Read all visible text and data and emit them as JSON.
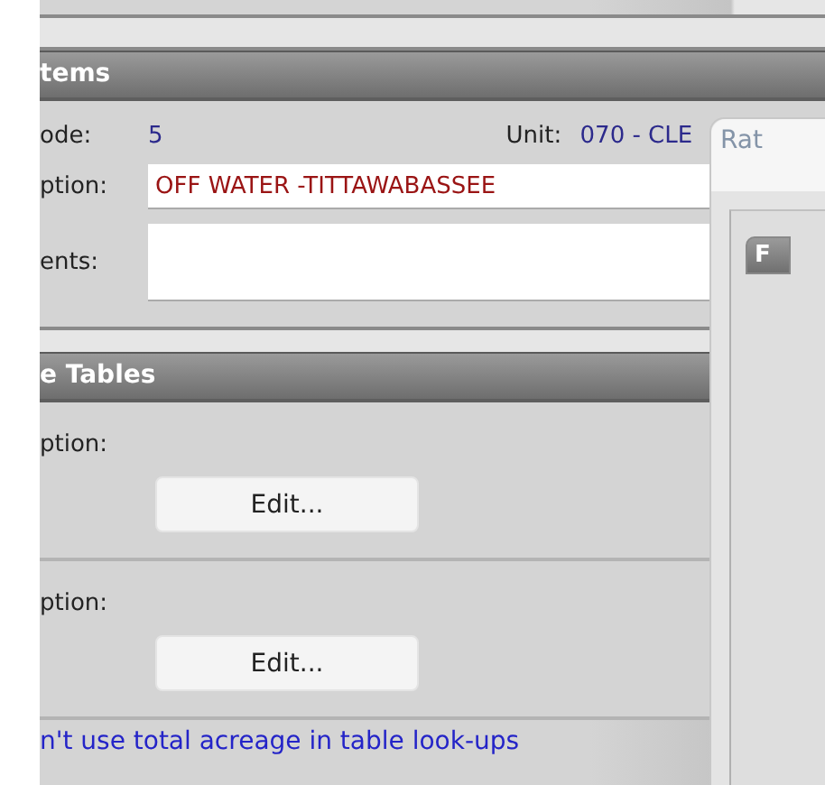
{
  "items_section": {
    "title": "tems",
    "code": {
      "label": "ode:",
      "value": "5"
    },
    "unit": {
      "label": "Unit:",
      "value": "070 - CLE"
    },
    "description": {
      "label": "ption:",
      "value": "OFF WATER -TITTAWABASSEE"
    },
    "comments": {
      "label": "ents:"
    }
  },
  "tables_section": {
    "title": "e Tables",
    "rows": [
      {
        "label": "ption:",
        "button": "Edit..."
      },
      {
        "label": "ption:",
        "button": "Edit..."
      }
    ],
    "link": "n't use total acreage in table look-ups"
  },
  "dialog": {
    "title": "Rat",
    "group_label": "F"
  }
}
